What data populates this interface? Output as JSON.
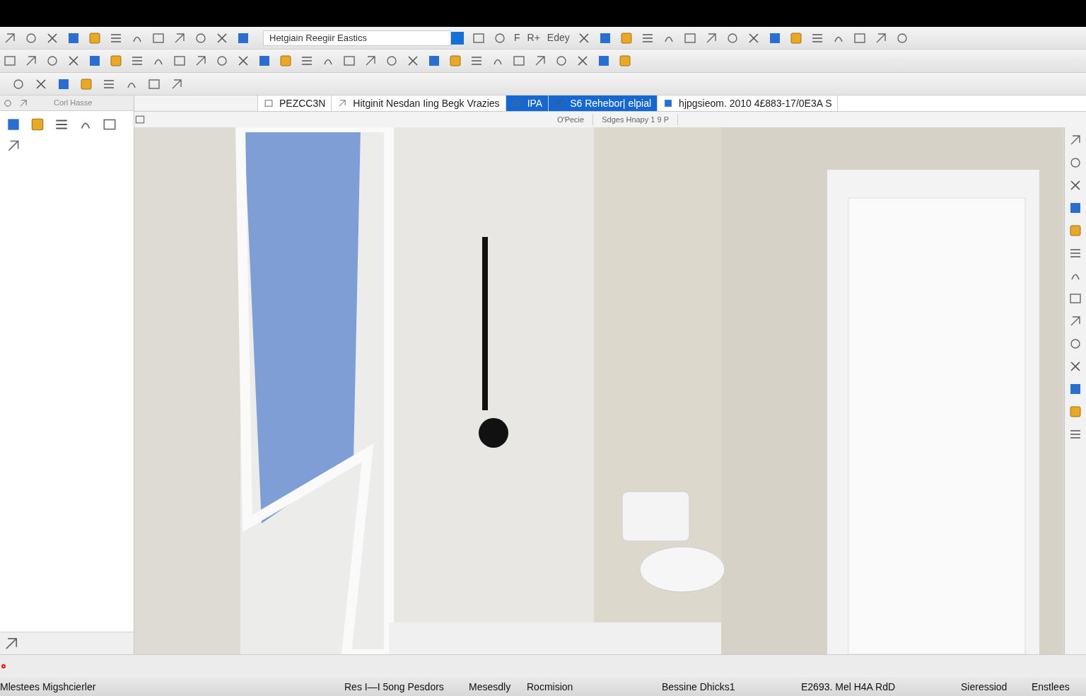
{
  "toolbar": {
    "search": {
      "value": "Hetgiain Reegiir Eastics"
    },
    "labels": [
      "F",
      "R+",
      "Edey"
    ]
  },
  "panel": {
    "title": "Corl Hasse"
  },
  "tabs": [
    {
      "label": "PEZCC3N",
      "selected": false
    },
    {
      "label": "Hitginit Nesdan Iing Begk Vrazies",
      "selected": false
    },
    {
      "label": "IPA",
      "selected": true
    },
    {
      "label": "S6 Rehebor| elpial",
      "selected": true
    },
    {
      "label": "hjpgsieom. 2010 4£883-17/0E3A S",
      "selected": false
    }
  ],
  "viewport": {
    "labels": [
      "O'Pecie",
      "Sdges Hnapy 1 9 P"
    ]
  },
  "status_bar": {
    "left": "Mlestees Migshcierler",
    "items": [
      "Res I—I 5ong Pesdors",
      "Mesesdly",
      "Rocmision",
      "Bessine Dhicks1",
      "E2693. Mel H4A RdD",
      "Sieressiod",
      "Enstlees"
    ]
  }
}
